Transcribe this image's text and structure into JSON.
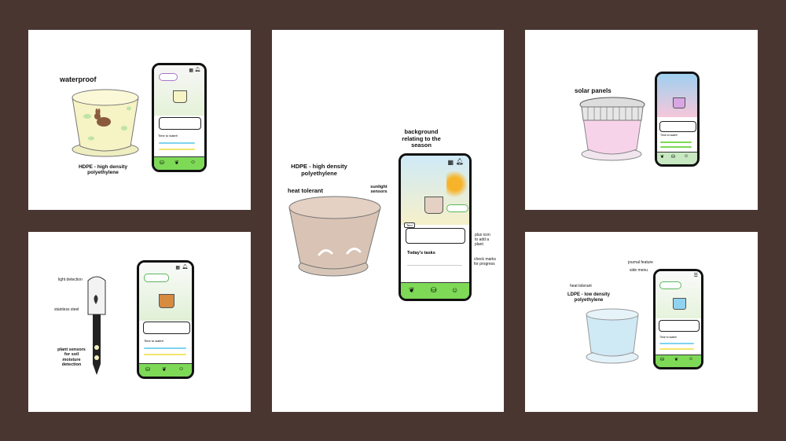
{
  "colors": {
    "background": "#4a3631",
    "panel": "#ffffff",
    "nav_green": "#7ed957",
    "pot_yellow": "#f6f3c4",
    "pot_tan": "#d9c3b4",
    "pot_pink": "#f7d3ea",
    "pot_blue": "#cfe9f5",
    "water_bar_blue": "#7fd3f0",
    "sun_bar_yellow": "#f5e56b"
  },
  "icons": [
    "calendar-icon",
    "bell-icon",
    "menu-icon",
    "pot-icon",
    "sprout-icon",
    "people-icon",
    "bunny-icon",
    "leaf-icon"
  ],
  "panel1": {
    "title": "waterproof",
    "material": "HDPE - high density\npolyethylene",
    "phone_subtitle": "Time to water!"
  },
  "panel2": {
    "season_label": "background\nrelating to the\nseason",
    "material": "HDPE - high density\npolyethylene",
    "heat": "heat tolerant",
    "sunlight": "sunlight\nsensors",
    "plus_note": "plus icon\nto add a\nplant",
    "check_note": "check marks\nfor progress",
    "tasks_title": "Today's tasks",
    "plant_tag": "Terri"
  },
  "panel3": {
    "title": "solar panels",
    "phone_subtitle": "Time to water!"
  },
  "panel4": {
    "light": "light detection",
    "steel": "stainless steel",
    "sensors": "plant sensors\nfor soil\nmoisture\ndetection",
    "phone_subtitle": "Time to water!"
  },
  "panel5": {
    "journal": "journal feature",
    "side_menu": "side menu",
    "heat": "heat tolerant",
    "material": "LDPE - low density\npolyethylene",
    "phone_subtitle": "Time to water!"
  }
}
